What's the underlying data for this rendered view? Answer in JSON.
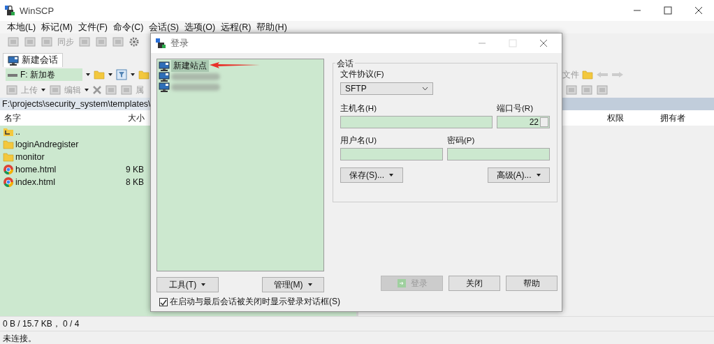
{
  "window": {
    "title": "WinSCP"
  },
  "menu": [
    "本地(L)",
    "标记(M)",
    "文件(F)",
    "命令(C)",
    "会话(S)",
    "选项(O)",
    "远程(R)",
    "帮助(H)"
  ],
  "toolbar": {
    "sync_label": "同步"
  },
  "session_tab": {
    "label": "新建会话",
    "selected": true
  },
  "local_panel": {
    "drive": "F: 新加卷",
    "upload": "上传",
    "edit": "编辑",
    "properties": "属",
    "path": "F:\\projects\\security_system\\templates\\",
    "columns": [
      "名字",
      "大小"
    ],
    "rows": [
      {
        "kind": "parent",
        "name": ".."
      },
      {
        "kind": "folder",
        "name": "loginAndregister"
      },
      {
        "kind": "folder",
        "name": "monitor"
      },
      {
        "kind": "html",
        "name": "home.html",
        "size": "9 KB"
      },
      {
        "kind": "html",
        "name": "index.html",
        "size": "8 KB"
      }
    ]
  },
  "remote_panel": {
    "toolbar_label": "文件",
    "columns": [
      "权限",
      "拥有者"
    ]
  },
  "status_bar": [
    "0 B / 15.7 KB， 0 / 4",
    "未连接。"
  ],
  "login_dialog": {
    "title": "登录",
    "sites": [
      {
        "label": "新建站点",
        "selected": true
      },
      {
        "selected": false
      },
      {
        "selected": false
      }
    ],
    "group_title": "会话",
    "protocol_label": "文件协议(F)",
    "protocol": "SFTP",
    "host_label": "主机名(H)",
    "port_label": "端口号(R)",
    "port": "22",
    "user_label": "用户名(U)",
    "password_label": "密码(P)",
    "save_button": "保存(S)...",
    "advanced_button": "高级(A)...",
    "tools_button": "工具(T)",
    "manage_button": "管理(M)",
    "login_button": {
      "label": "登录",
      "disabled": true
    },
    "close_button": "关闭",
    "help_button": "帮助",
    "show_on_startup": {
      "label": "在启动与最后会话被关闭时显示登录对话框(S)",
      "checked": true
    }
  }
}
